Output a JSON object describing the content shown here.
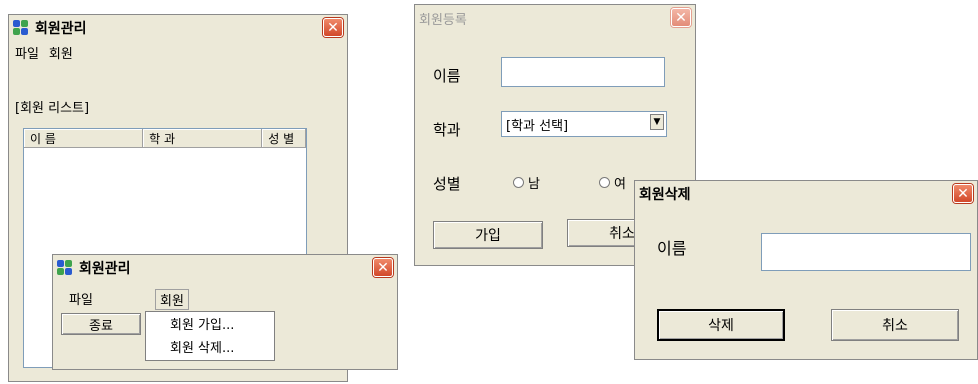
{
  "list_window": {
    "title": "회원관리",
    "menu": [
      "파일",
      "회원"
    ],
    "list_label": "[회원 리스트]",
    "columns": [
      "이 름",
      "학 과",
      "성 별"
    ]
  },
  "menu_window": {
    "title": "회원관리",
    "menu": [
      "파일",
      "회원"
    ],
    "file_item": "종료",
    "member_items": [
      "회원 가입...",
      "회원 삭제..."
    ]
  },
  "register_window": {
    "title": "회원등록",
    "name_label": "이름",
    "dept_label": "학과",
    "dept_value": "[학과 선택]",
    "gender_label": "성별",
    "gender_male": "남",
    "gender_female": "여",
    "join_button": "가입",
    "cancel_button": "취소"
  },
  "delete_window": {
    "title": "회원삭제",
    "name_label": "이름",
    "delete_button": "삭제",
    "cancel_button": "취소"
  },
  "colors": {
    "close_red": "#d2482a",
    "window_bg": "#ece9d8",
    "input_border": "#7f9db9"
  }
}
